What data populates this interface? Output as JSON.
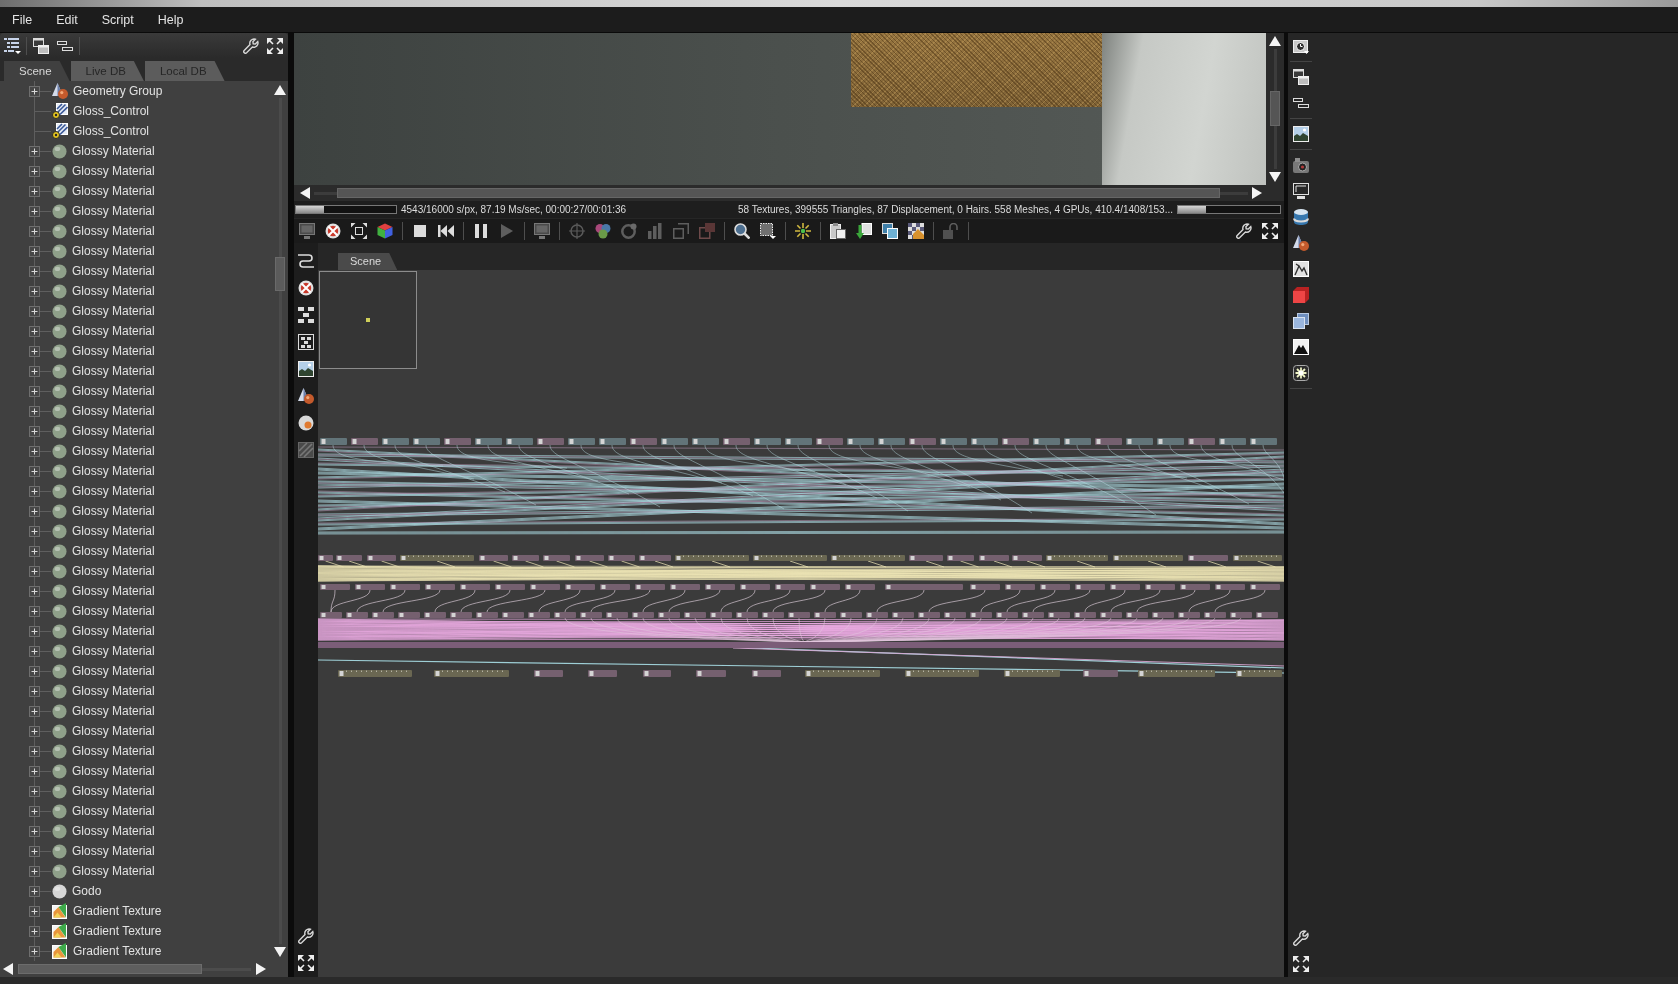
{
  "menu": [
    "File",
    "Edit",
    "Script",
    "Help"
  ],
  "scene_panel": {
    "tabs": [
      {
        "label": "Scene",
        "selected": true
      },
      {
        "label": "Live DB",
        "selected": false
      },
      {
        "label": "Local DB",
        "selected": false
      }
    ],
    "tree": [
      {
        "label": "Geometry Group",
        "kind": "geometry",
        "expandable": true
      },
      {
        "label": "Gloss_Control",
        "kind": "texture",
        "expandable": false
      },
      {
        "label": "Gloss_Control",
        "kind": "texture",
        "expandable": false
      },
      {
        "label": "Glossy Material",
        "kind": "material",
        "expandable": true,
        "color": "#8fa08a"
      },
      {
        "label": "Glossy Material",
        "kind": "material",
        "expandable": true,
        "color": "#8fa08a"
      },
      {
        "label": "Glossy Material",
        "kind": "material",
        "expandable": true,
        "color": "#8fa08a"
      },
      {
        "label": "Glossy Material",
        "kind": "material",
        "expandable": true,
        "color": "#8fa08a"
      },
      {
        "label": "Glossy Material",
        "kind": "material",
        "expandable": true,
        "color": "#8fa08a"
      },
      {
        "label": "Glossy Material",
        "kind": "material",
        "expandable": true,
        "color": "#8fa08a"
      },
      {
        "label": "Glossy Material",
        "kind": "material",
        "expandable": true,
        "color": "#8fa08a"
      },
      {
        "label": "Glossy Material",
        "kind": "material",
        "expandable": true,
        "color": "#8fa08a"
      },
      {
        "label": "Glossy Material",
        "kind": "material",
        "expandable": true,
        "color": "#8fa08a"
      },
      {
        "label": "Glossy Material",
        "kind": "material",
        "expandable": true,
        "color": "#8fa08a"
      },
      {
        "label": "Glossy Material",
        "kind": "material",
        "expandable": true,
        "color": "#8fa08a"
      },
      {
        "label": "Glossy Material",
        "kind": "material",
        "expandable": true,
        "color": "#8fa08a"
      },
      {
        "label": "Glossy Material",
        "kind": "material",
        "expandable": true,
        "color": "#8fa08a"
      },
      {
        "label": "Glossy Material",
        "kind": "material",
        "expandable": true,
        "color": "#8fa08a"
      },
      {
        "label": "Glossy Material",
        "kind": "material",
        "expandable": true,
        "color": "#8fa08a"
      },
      {
        "label": "Glossy Material",
        "kind": "material",
        "expandable": true,
        "color": "#8fa08a"
      },
      {
        "label": "Glossy Material",
        "kind": "material",
        "expandable": true,
        "color": "#8fa08a"
      },
      {
        "label": "Glossy Material",
        "kind": "material",
        "expandable": true,
        "color": "#8fa08a"
      },
      {
        "label": "Glossy Material",
        "kind": "material",
        "expandable": true,
        "color": "#8fa08a"
      },
      {
        "label": "Glossy Material",
        "kind": "material",
        "expandable": true,
        "color": "#8fa08a"
      },
      {
        "label": "Glossy Material",
        "kind": "material",
        "expandable": true,
        "color": "#8fa08a"
      },
      {
        "label": "Glossy Material",
        "kind": "material",
        "expandable": true,
        "color": "#8fa08a"
      },
      {
        "label": "Glossy Material",
        "kind": "material",
        "expandable": true,
        "color": "#8fa08a"
      },
      {
        "label": "Glossy Material",
        "kind": "material",
        "expandable": true,
        "color": "#8fa08a"
      },
      {
        "label": "Glossy Material",
        "kind": "material",
        "expandable": true,
        "color": "#8fa08a"
      },
      {
        "label": "Glossy Material",
        "kind": "material",
        "expandable": true,
        "color": "#8fa08a"
      },
      {
        "label": "Glossy Material",
        "kind": "material",
        "expandable": true,
        "color": "#8fa08a"
      },
      {
        "label": "Glossy Material",
        "kind": "material",
        "expandable": true,
        "color": "#8fa08a"
      },
      {
        "label": "Glossy Material",
        "kind": "material",
        "expandable": true,
        "color": "#8fa08a"
      },
      {
        "label": "Glossy Material",
        "kind": "material",
        "expandable": true,
        "color": "#8fa08a"
      },
      {
        "label": "Glossy Material",
        "kind": "material",
        "expandable": true,
        "color": "#8fa08a"
      },
      {
        "label": "Glossy Material",
        "kind": "material",
        "expandable": true,
        "color": "#8fa08a"
      },
      {
        "label": "Glossy Material",
        "kind": "material",
        "expandable": true,
        "color": "#8fa08a"
      },
      {
        "label": "Glossy Material",
        "kind": "material",
        "expandable": true,
        "color": "#8fa08a"
      },
      {
        "label": "Glossy Material",
        "kind": "material",
        "expandable": true,
        "color": "#8fa08a"
      },
      {
        "label": "Glossy Material",
        "kind": "material",
        "expandable": true,
        "color": "#8fa08a"
      },
      {
        "label": "Glossy Material",
        "kind": "material",
        "expandable": true,
        "color": "#8fa08a"
      },
      {
        "label": "Godo",
        "kind": "material",
        "expandable": true,
        "color": "#d6d6d6"
      },
      {
        "label": "Gradient Texture",
        "kind": "gradient",
        "expandable": true
      },
      {
        "label": "Gradient Texture",
        "kind": "gradient",
        "expandable": true
      },
      {
        "label": "Gradient Texture",
        "kind": "gradient",
        "expandable": true
      }
    ]
  },
  "render_view": {
    "progress": {
      "level": 0.28
    },
    "render_stats": "4543/16000 s/px, 87.19 Ms/sec, 00:00:27/00:01:36",
    "scene_stats": "58 Textures, 399555 Triangles, 87 Displacement, 0 Hairs. 558 Meshes, 4 GPUs, 410.4/1408/153...",
    "memory": {
      "level": 0.27
    }
  },
  "node_editor": {
    "tabs": [
      {
        "label": "Scene",
        "selected": true
      }
    ]
  }
}
